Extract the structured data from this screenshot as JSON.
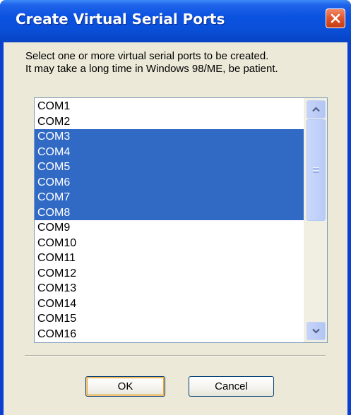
{
  "window": {
    "title": "Create Virtual Serial Ports"
  },
  "instructions": {
    "line1": "Select one or more virtual serial ports to be created.",
    "line2": "It may take a long time in Windows 98/ME, be patient."
  },
  "ports": [
    {
      "label": "COM1",
      "selected": false
    },
    {
      "label": "COM2",
      "selected": false
    },
    {
      "label": "COM3",
      "selected": true
    },
    {
      "label": "COM4",
      "selected": true
    },
    {
      "label": "COM5",
      "selected": true
    },
    {
      "label": "COM6",
      "selected": true
    },
    {
      "label": "COM7",
      "selected": true
    },
    {
      "label": "COM8",
      "selected": true
    },
    {
      "label": "COM9",
      "selected": false
    },
    {
      "label": "COM10",
      "selected": false
    },
    {
      "label": "COM11",
      "selected": false
    },
    {
      "label": "COM12",
      "selected": false
    },
    {
      "label": "COM13",
      "selected": false
    },
    {
      "label": "COM14",
      "selected": false
    },
    {
      "label": "COM15",
      "selected": false
    },
    {
      "label": "COM16",
      "selected": false
    }
  ],
  "buttons": {
    "ok_label": "OK",
    "cancel_label": "Cancel"
  },
  "icons": {
    "close": "close-icon",
    "scroll_up": "chevron-up-icon",
    "scroll_down": "chevron-down-icon",
    "scroll_grip": "grip-icon"
  },
  "colors": {
    "titlebar": "#0a52e0",
    "close_button": "#e0542a",
    "selection": "#316ac5",
    "dialog_face": "#ece9d8"
  }
}
